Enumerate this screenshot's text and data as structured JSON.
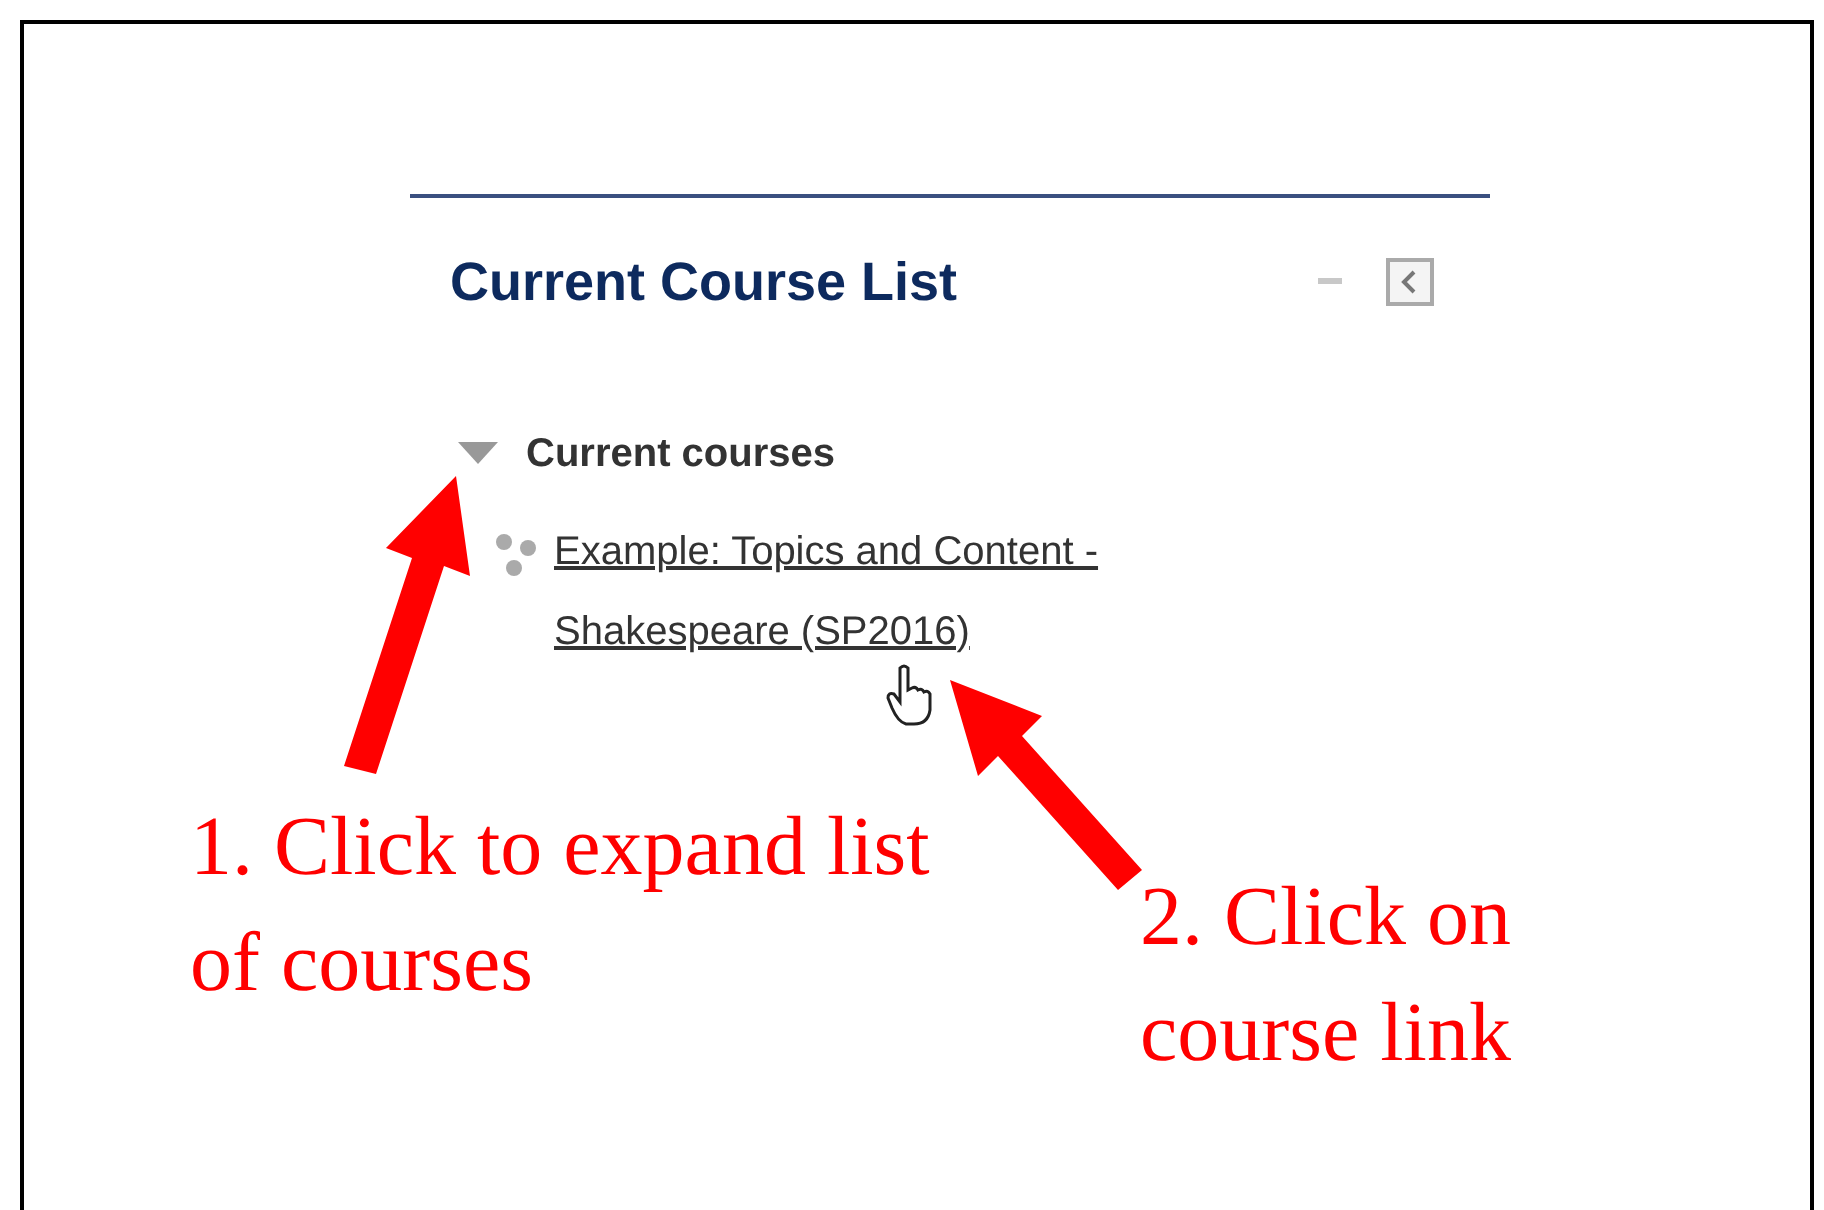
{
  "block": {
    "title": "Current Course List"
  },
  "tree": [
    {
      "label": "Current courses",
      "expanded": true,
      "children": [
        {
          "label": "Example: Topics and Content - Shakespeare (SP2016)"
        }
      ]
    }
  ],
  "annotations": [
    {
      "text": "1. Click to expand list of courses"
    },
    {
      "text": "2. Click on course link"
    }
  ]
}
